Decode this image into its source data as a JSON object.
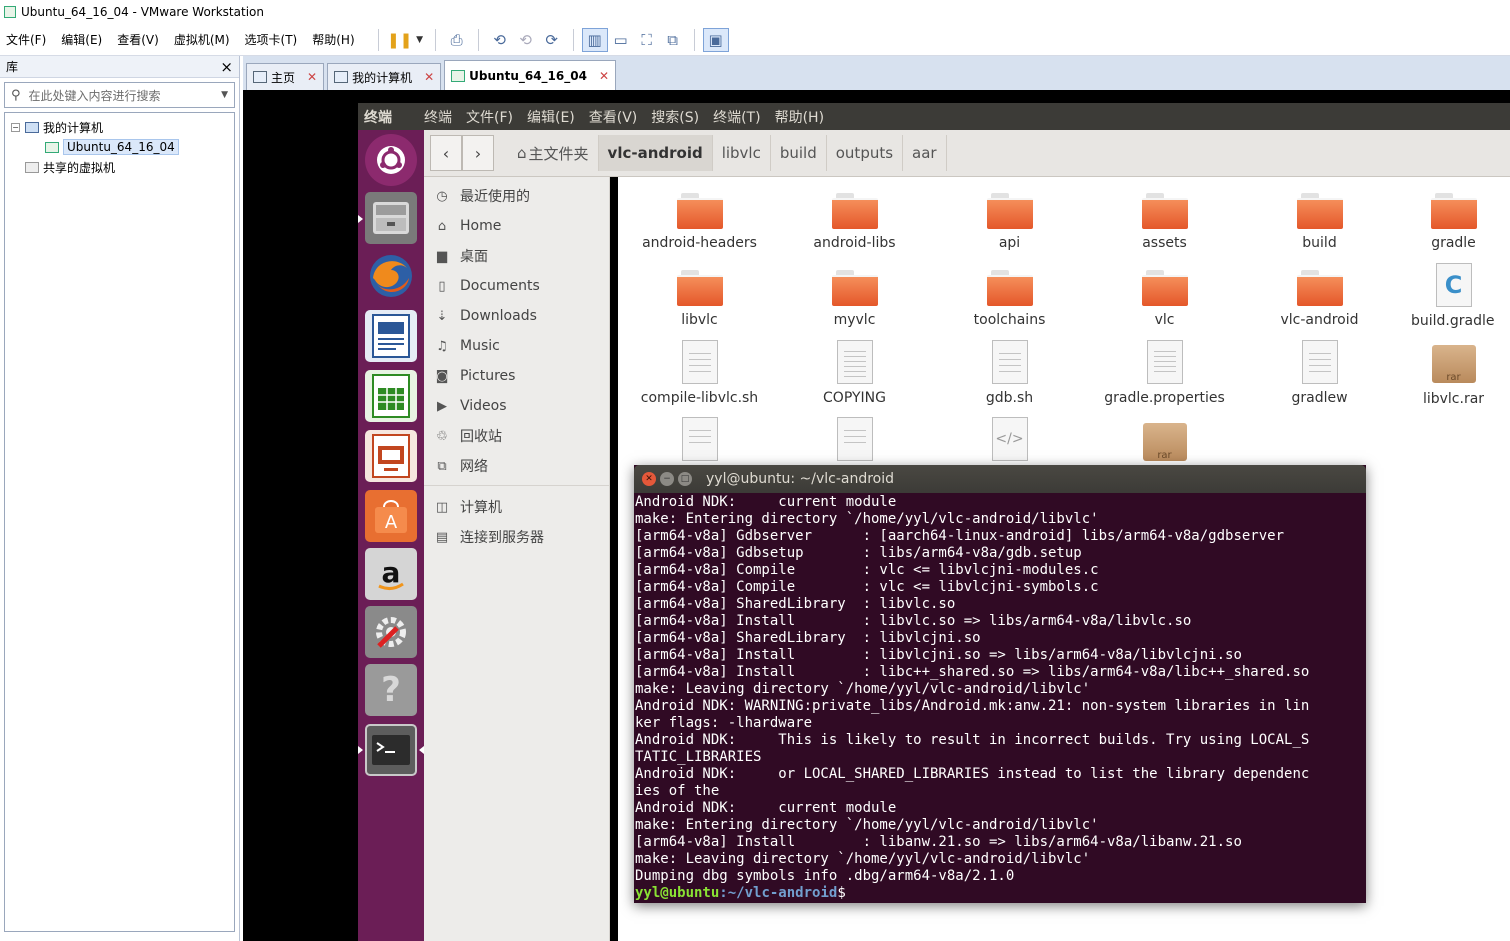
{
  "window": {
    "title": "Ubuntu_64_16_04 - VMware Workstation"
  },
  "menu": [
    "文件(F)",
    "编辑(E)",
    "查看(V)",
    "虚拟机(M)",
    "选项卡(T)",
    "帮助(H)"
  ],
  "library": {
    "header": "库",
    "close": "×",
    "search_placeholder": "在此处键入内容进行搜索",
    "tree": {
      "root": "我的计算机",
      "vm": "Ubuntu_64_16_04",
      "shared": "共享的虚拟机"
    }
  },
  "tabs": [
    {
      "label": "主页"
    },
    {
      "label": "我的计算机"
    },
    {
      "label": "Ubuntu_64_16_04"
    }
  ],
  "ubuntu": {
    "top_app": "终端",
    "top_menu": [
      "终端",
      "文件(F)",
      "编辑(E)",
      "查看(V)",
      "搜索(S)",
      "终端(T)",
      "帮助(H)"
    ]
  },
  "nautilus": {
    "breadcrumbs": [
      "主文件夹",
      "vlc-android",
      "libvlc",
      "build",
      "outputs",
      "aar"
    ],
    "places": [
      "最近使用的",
      "Home",
      "桌面",
      "Documents",
      "Downloads",
      "Music",
      "Pictures",
      "Videos",
      "回收站",
      "网络",
      "计算机",
      "连接到服务器"
    ],
    "files": [
      {
        "name": "android-headers",
        "kind": "folder"
      },
      {
        "name": "android-libs",
        "kind": "folder"
      },
      {
        "name": "api",
        "kind": "folder"
      },
      {
        "name": "assets",
        "kind": "folder"
      },
      {
        "name": "build",
        "kind": "folder"
      },
      {
        "name": "gradle",
        "kind": "folder"
      },
      {
        "name": "libvlc",
        "kind": "folder"
      },
      {
        "name": "myvlc",
        "kind": "folder"
      },
      {
        "name": "toolchains",
        "kind": "folder"
      },
      {
        "name": "vlc",
        "kind": "folder"
      },
      {
        "name": "vlc-android",
        "kind": "folder"
      },
      {
        "name": "build.gradle",
        "kind": "c-file"
      },
      {
        "name": "compile-libvlc.sh",
        "kind": "script"
      },
      {
        "name": "COPYING",
        "kind": "text"
      },
      {
        "name": "gdb.sh",
        "kind": "script"
      },
      {
        "name": "gradle.properties",
        "kind": "text"
      },
      {
        "name": "gradlew",
        "kind": "script"
      },
      {
        "name": "libvlc.rar",
        "kind": "archive"
      }
    ]
  },
  "terminal": {
    "title": "yyl@ubuntu: ~/vlc-android",
    "lines": [
      "Android NDK:     current module",
      "make: Entering directory `/home/yyl/vlc-android/libvlc'",
      "[arm64-v8a] Gdbserver      : [aarch64-linux-android] libs/arm64-v8a/gdbserver",
      "[arm64-v8a] Gdbsetup       : libs/arm64-v8a/gdb.setup",
      "[arm64-v8a] Compile        : vlc <= libvlcjni-modules.c",
      "[arm64-v8a] Compile        : vlc <= libvlcjni-symbols.c",
      "[arm64-v8a] SharedLibrary  : libvlc.so",
      "[arm64-v8a] Install        : libvlc.so => libs/arm64-v8a/libvlc.so",
      "[arm64-v8a] SharedLibrary  : libvlcjni.so",
      "[arm64-v8a] Install        : libvlcjni.so => libs/arm64-v8a/libvlcjni.so",
      "[arm64-v8a] Install        : libc++_shared.so => libs/arm64-v8a/libc++_shared.so",
      "make: Leaving directory `/home/yyl/vlc-android/libvlc'",
      "Android NDK: WARNING:private_libs/Android.mk:anw.21: non-system libraries in lin",
      "ker flags: -lhardware",
      "Android NDK:     This is likely to result in incorrect builds. Try using LOCAL_S",
      "TATIC_LIBRARIES",
      "Android NDK:     or LOCAL_SHARED_LIBRARIES instead to list the library dependenc",
      "ies of the",
      "Android NDK:     current module",
      "make: Entering directory `/home/yyl/vlc-android/libvlc'",
      "[arm64-v8a] Install        : libanw.21.so => libs/arm64-v8a/libanw.21.so",
      "make: Leaving directory `/home/yyl/vlc-android/libvlc'",
      "Dumping dbg symbols info .dbg/arm64-v8a/2.1.0"
    ],
    "prompt_user": "yyl@ubuntu",
    "prompt_path": ":~/vlc-android",
    "prompt_sign": "$"
  }
}
